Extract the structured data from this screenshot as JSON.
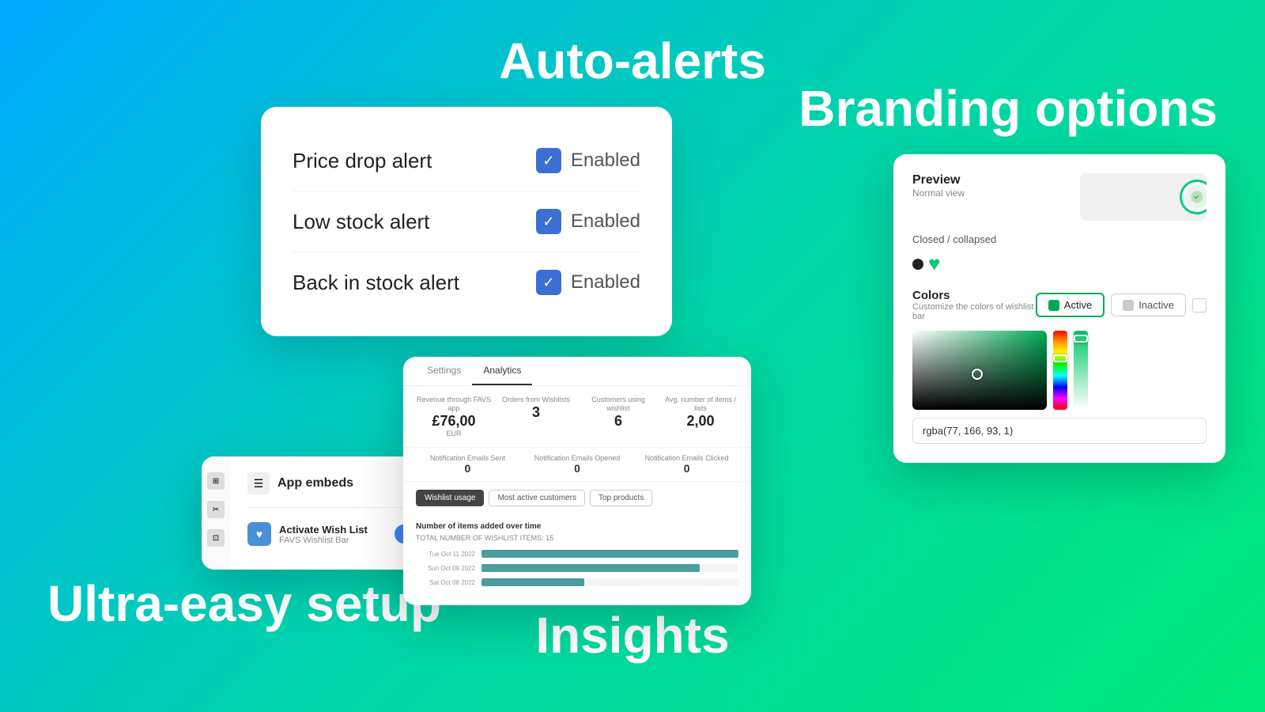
{
  "background": {
    "gradient_start": "#00aaff",
    "gradient_end": "#00e87a"
  },
  "hero": {
    "auto_alerts": "Auto-alerts",
    "branding_options": "Branding options",
    "ultra_easy_setup": "Ultra-easy setup",
    "insights": "Insights"
  },
  "alerts_card": {
    "items": [
      {
        "label": "Price drop alert",
        "status": "Enabled"
      },
      {
        "label": "Low stock alert",
        "status": "Enabled"
      },
      {
        "label": "Back in stock alert",
        "status": "Enabled"
      }
    ]
  },
  "embeds_card": {
    "title": "App embeds",
    "item": {
      "name": "Activate Wish List",
      "sub": "FAVS Wishlist Bar"
    }
  },
  "analytics_card": {
    "tabs": [
      "Settings",
      "Analytics"
    ],
    "active_tab": "Analytics",
    "stats": [
      {
        "label": "Revenue through FAVS app",
        "value": "£76,00",
        "sub": "EUR"
      },
      {
        "label": "Orders from Wishlists",
        "value": "3"
      },
      {
        "label": "Customers using wishlist",
        "value": "6"
      },
      {
        "label": "Avg. number of items / lists",
        "value": "2,00"
      }
    ],
    "email_stats": [
      {
        "label": "Notification Emails Sent",
        "value": "0"
      },
      {
        "label": "Notification Emails Opened",
        "value": "0"
      },
      {
        "label": "Notification Emails Clicked",
        "value": "0"
      }
    ],
    "filter_tabs": [
      "Wishlist usage",
      "Most active customers",
      "Top products"
    ],
    "active_filter": "Wishlist usage",
    "chart": {
      "title": "Number of items added over time",
      "subtitle": "TOTAL NUMBER OF WISHLIST ITEMS: 15",
      "bars": [
        {
          "date": "Tue Oct 11 2022",
          "value": 100
        },
        {
          "date": "Sun Oct 09 2022",
          "value": 85
        },
        {
          "date": "Sat Oct 08 2022",
          "value": 40
        }
      ]
    }
  },
  "branding_card": {
    "preview": {
      "title": "Preview",
      "sub": "Normal view"
    },
    "closed_collapsed": "Closed / collapsed",
    "colors": {
      "title": "Colors",
      "sub": "Customize the colors of wishlist bar",
      "active_label": "Active",
      "inactive_label": "Inactive"
    },
    "color_value": "rgba(77, 166, 93, 1)"
  }
}
